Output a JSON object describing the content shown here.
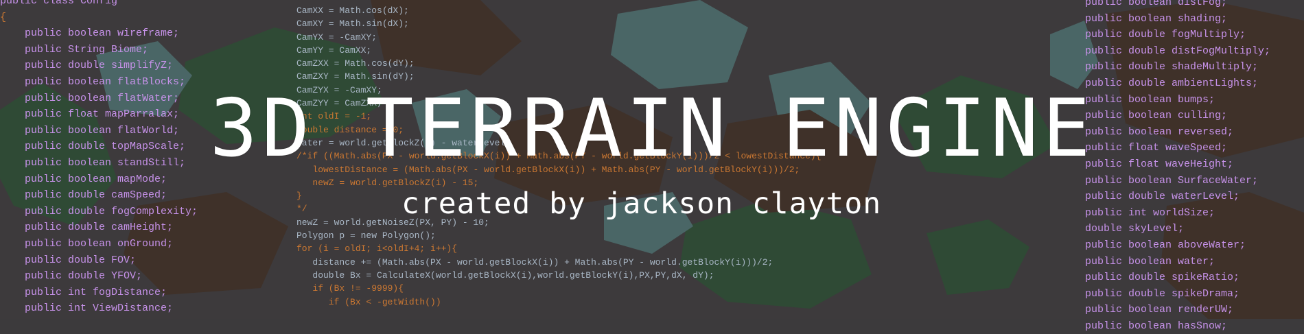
{
  "banner": {
    "title": "3D TERRAIN ENGINE",
    "subtitle": "created by jackson clayton"
  },
  "code_left": [
    "public class Config",
    "{",
    "    public boolean wireframe;",
    "    public String Biome;",
    "    public double simplifyZ;",
    "    public boolean flatBlocks;",
    "    public boolean flatWater;",
    "    public float mapParralax;",
    "    public boolean flatWorld;",
    "    public double topMapScale;",
    "    public boolean standStill;",
    "    public boolean mapMode;",
    "    public double camSpeed;",
    "    public double fogComplexity;",
    "    public double camHeight;",
    "    public boolean onGround;",
    "    public double FOV;",
    "    public double YFOV;",
    "    public int fogDistance;",
    "    public int ViewDistance;"
  ],
  "code_mid": [
    "CamXX = Math.cos(dX);",
    "CamXY = Math.sin(dX);",
    "CamYX = -CamXY;",
    "CamYY = CamXX;",
    "CamZXX = Math.cos(dY);",
    "CamZXY = Math.sin(dY);",
    "CamZYX = -CamXY;",
    "CamZYY = CamZXX;",
    "int oldI = -1;",
    "double distance = 0;",
    "",
    "water = world.getBlockZ(i) - waterLevel;",
    "/*if ((Math.abs(PX - world.getBlockX(i)) + Math.abs(PY - world.getBlockY(i)))/2 < lowestDistance){",
    "   lowestDistance = (Math.abs(PX - world.getBlockX(i)) + Math.abs(PY - world.getBlockY(i)))/2;",
    "   newZ = world.getBlockZ(i) - 15;",
    "}",
    "*/",
    "newZ = world.getNoiseZ(PX, PY) - 10;",
    "Polygon p = new Polygon();",
    "for (i = oldI; i<oldI+4; i++){",
    "   distance += (Math.abs(PX - world.getBlockX(i)) + Math.abs(PY - world.getBlockY(i)))/2;",
    "   double Bx = CalculateX(world.getBlockX(i),world.getBlockY(i),PX,PY,dX, dY);",
    "   if (Bx != -9999){",
    "      if (Bx < -getWidth())"
  ],
  "code_right": [
    "public boolean distFog;",
    "public boolean shading;",
    "public double fogMultiply;",
    "public double distFogMultiply;",
    "public double shadeMultiply;",
    "public double ambientLights;",
    "public boolean bumps;",
    "public boolean culling;",
    "public boolean reversed;",
    "public float waveSpeed;",
    "public float waveHeight;",
    "public boolean SurfaceWater;",
    "public double waterLevel;",
    "public int worldSize;",
    "double skyLevel;",
    "public boolean aboveWater;",
    "public boolean water;",
    "public double spikeRatio;",
    "public double spikeDrama;",
    "public boolean renderUW;",
    "public boolean hasSnow;"
  ],
  "colors": {
    "background": "#3c3a3c",
    "terrain_brown": "#3f3129",
    "terrain_green": "#2f4a35",
    "terrain_teal": "#4e6a6a",
    "keyword": "#c87fb8",
    "identifier": "#a9b1d6",
    "comment": "#cc7832",
    "title": "#ffffff"
  }
}
